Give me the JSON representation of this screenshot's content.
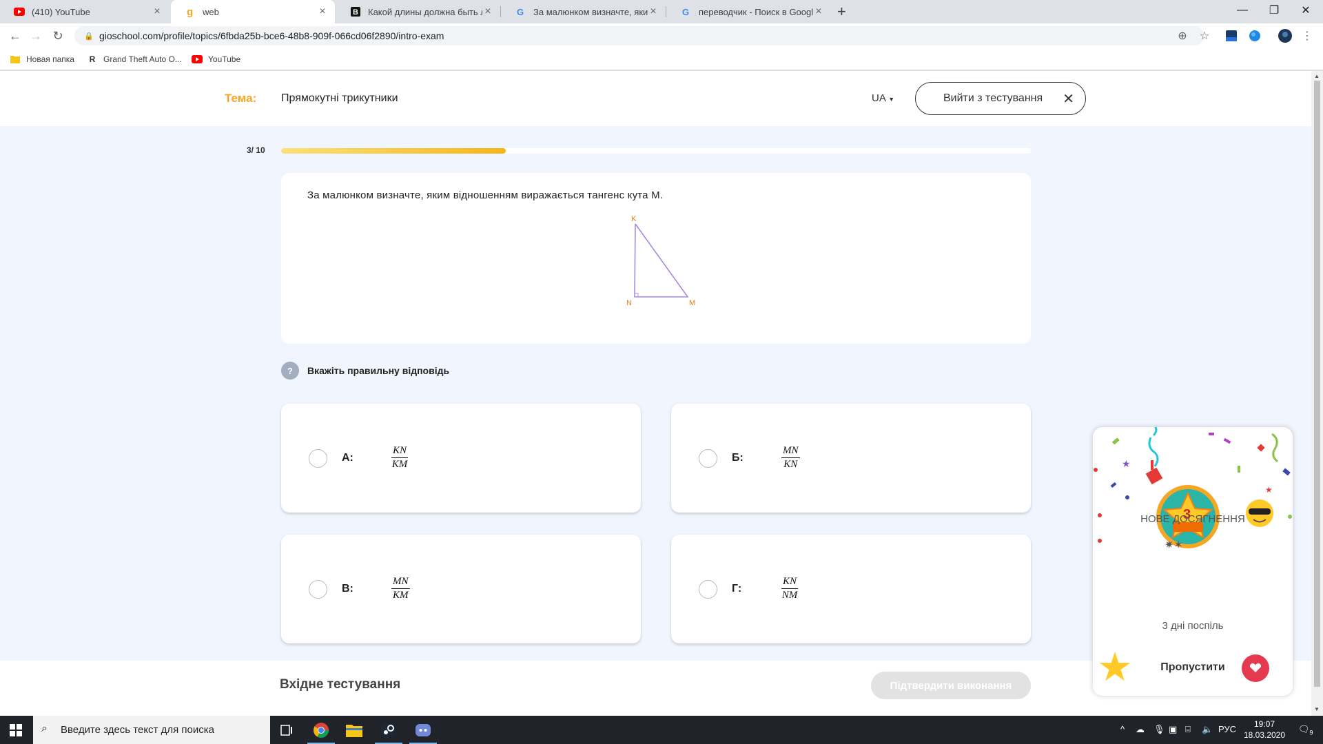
{
  "browser": {
    "tabs": [
      {
        "title": "(410) YouTube",
        "icon": "youtube-icon"
      },
      {
        "title": "web",
        "icon": "gioschool-icon"
      },
      {
        "title": "Какой длины должна быть лест",
        "icon": "znanija-icon"
      },
      {
        "title": "За малюнком визначте, яким ві",
        "icon": "google-icon"
      },
      {
        "title": "переводчик - Поиск в Google",
        "icon": "google-icon"
      }
    ],
    "active_tab": 1,
    "url": "gioschool.com/profile/topics/6fbda25b-bce6-48b8-909f-066cd06f2890/intro-exam",
    "bookmarks": [
      {
        "label": "Новая папка",
        "icon": "folder-icon"
      },
      {
        "label": "Grand Theft Auto O...",
        "icon": "rockstar-icon"
      },
      {
        "label": "YouTube",
        "icon": "youtube-icon"
      }
    ]
  },
  "header": {
    "topic_label": "Тема:",
    "topic_value": "Прямокутні трикутники",
    "language": "UA",
    "exit_label": "Вийти з тестування"
  },
  "progress": {
    "label": "3/ 10",
    "current": 3,
    "total": 10
  },
  "question": {
    "text": "За малюнком визначте, яким відношенням виражається  тангенс  кута  М.",
    "figure": {
      "vertex_labels": [
        "K",
        "N",
        "M"
      ],
      "stroke_color": "#a78bdc",
      "label_color": "#f07c1a"
    }
  },
  "hint": {
    "icon_text": "?",
    "text": "Вкажіть правильну відповідь"
  },
  "options": [
    {
      "letter": "А:",
      "numerator": "KN",
      "denominator": "KM"
    },
    {
      "letter": "Б:",
      "numerator": "MN",
      "denominator": "KN"
    },
    {
      "letter": "В:",
      "numerator": "MN",
      "denominator": "KM"
    },
    {
      "letter": "Г:",
      "numerator": "KN",
      "denominator": "NM"
    }
  ],
  "footer": {
    "title": "Вхідне тестування",
    "confirm_label": "Підтвердити виконання"
  },
  "achievement": {
    "title": "НОВЕ ДОСЯГНЕННЯ",
    "badge_number": "3",
    "subtitle": "3 дні поспіль",
    "skip_label": "Пропустити"
  },
  "taskbar": {
    "search_placeholder": "Введите здесь текст для поиска",
    "language": "РУС",
    "time": "19:07",
    "date": "18.03.2020",
    "notifications": "9"
  },
  "colors": {
    "accent_orange": "#f5a623",
    "progress_yellow": "#f6b51a",
    "page_bg": "#f1f5fd"
  }
}
